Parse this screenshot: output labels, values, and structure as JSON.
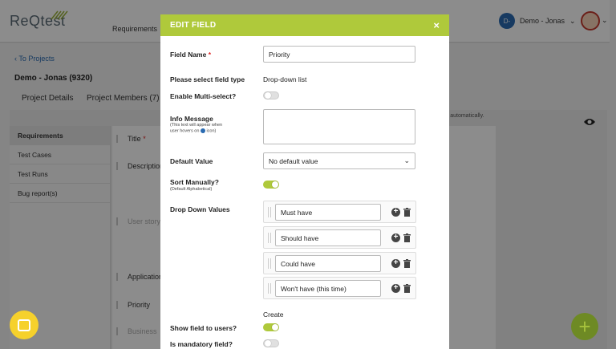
{
  "app": {
    "logo_text": "ReQtest",
    "nav": {
      "requirements": "Requirements"
    },
    "user": {
      "initials": "D-",
      "name": "Demo - Jonas"
    }
  },
  "breadcrumb": {
    "to_projects": "To Projects"
  },
  "project": {
    "title": "Demo - Jonas (9320)"
  },
  "tabs": {
    "details": "Project Details",
    "members": "Project Members (7)"
  },
  "sidebar": {
    "items": [
      {
        "label": "Requirements",
        "active": true
      },
      {
        "label": "Test Cases"
      },
      {
        "label": "Test Runs"
      },
      {
        "label": "Bug report(s)"
      }
    ]
  },
  "background_fields": {
    "title": "Title",
    "description": "Description",
    "user_story": "User story",
    "application": "Application",
    "priority": "Priority",
    "business": "Business"
  },
  "notice": "ved automatically.",
  "modal": {
    "title": "EDIT FIELD",
    "close": "×",
    "field_name_label": "Field Name",
    "field_name_value": "Priority",
    "field_type_label": "Please select field type",
    "field_type_value": "Drop-down list",
    "multi_select_label": "Enable Multi-select?",
    "info_label": "Info Message",
    "info_hint_1": "(This text will appear when",
    "info_hint_2": "user hovers on",
    "info_hint_3": "icon)",
    "default_label": "Default Value",
    "default_value": "No default value",
    "sort_label": "Sort Manually?",
    "sort_hint": "(Default Alphabetical)",
    "dd_label": "Drop Down Values",
    "dd_values": [
      "Must have",
      "Should have",
      "Could have",
      "Won't have (this time)"
    ],
    "create": "Create",
    "show_label": "Show field to users?",
    "mandatory_label": "Is mandatory field?",
    "toggles": {
      "multi_select": false,
      "sort_manually": true,
      "show_field": true,
      "mandatory": false
    }
  },
  "colors": {
    "accent": "#afc93b",
    "link": "#2a6bb1",
    "chat": "#f6d12c"
  },
  "icons": [
    "close-icon",
    "chevron-down-icon",
    "eye-icon",
    "plus-circle-icon",
    "trash-icon",
    "drag-handle-icon",
    "chat-icon",
    "info-icon",
    "chevron-left-icon"
  ]
}
